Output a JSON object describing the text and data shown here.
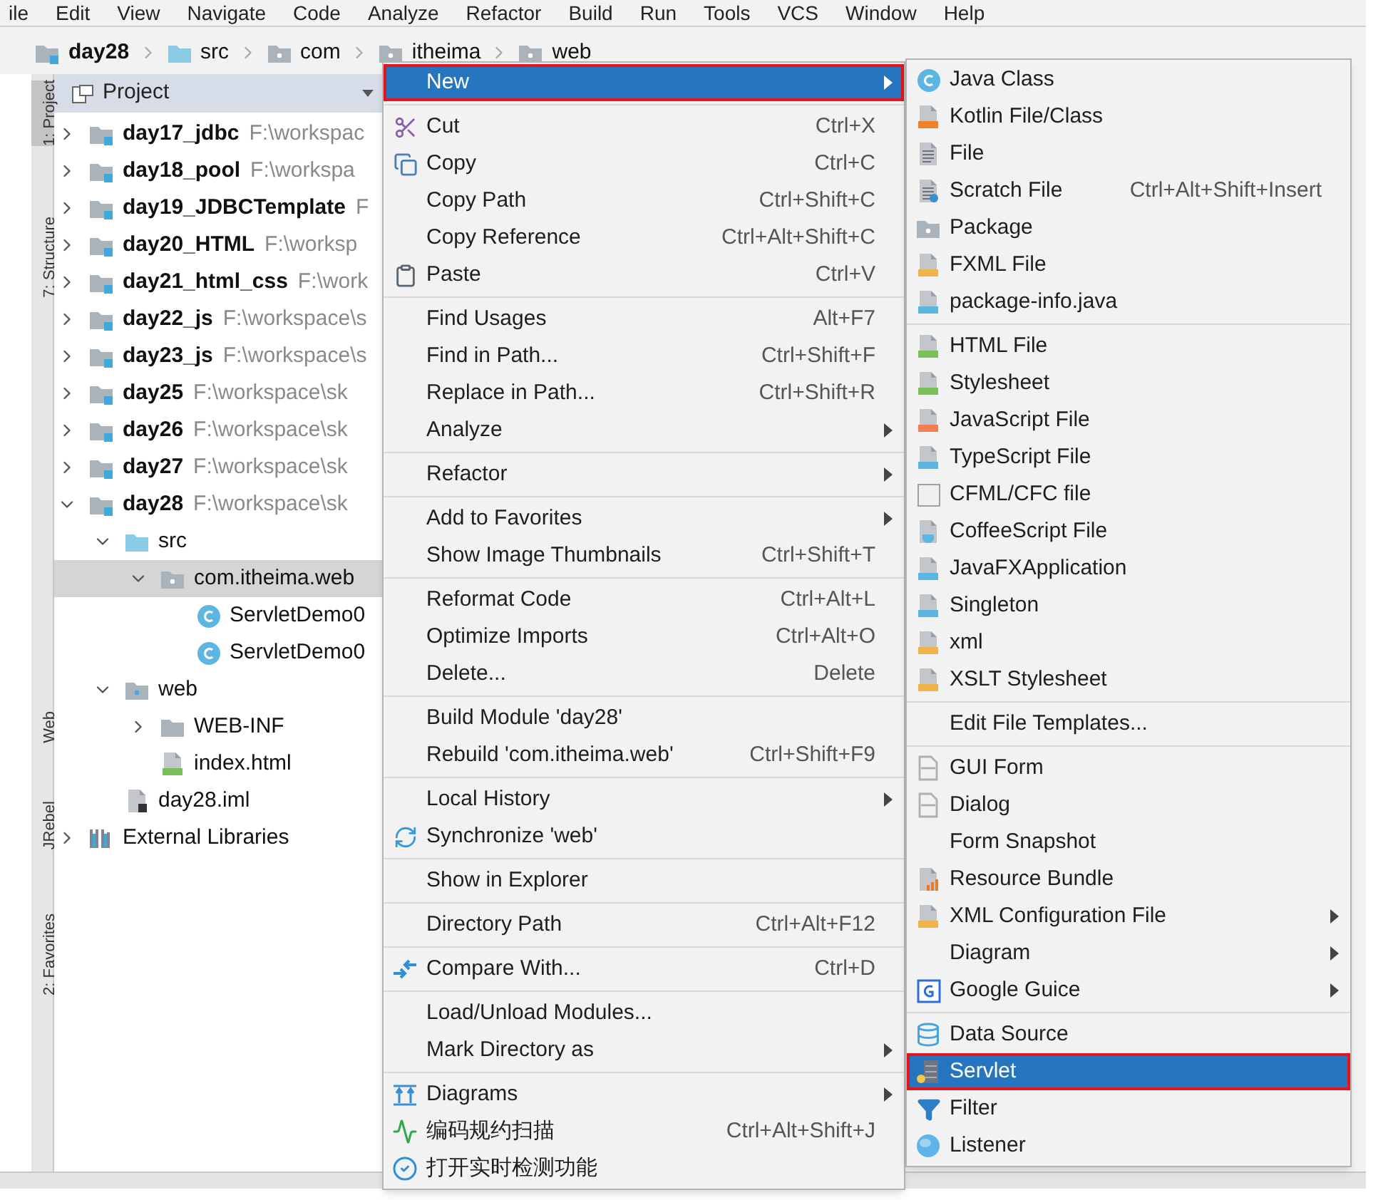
{
  "menu_bar": [
    "ile",
    "Edit",
    "View",
    "Navigate",
    "Code",
    "Analyze",
    "Refactor",
    "Build",
    "Run",
    "Tools",
    "VCS",
    "Window",
    "Help"
  ],
  "breadcrumbs": [
    {
      "label": "day28",
      "kind": "module"
    },
    {
      "label": "src",
      "kind": "source-folder"
    },
    {
      "label": "com",
      "kind": "package"
    },
    {
      "label": "itheima",
      "kind": "package"
    },
    {
      "label": "web",
      "kind": "package"
    }
  ],
  "tool_window_tabs": [
    {
      "label": "1: Project",
      "selected": true
    },
    {
      "label": "7: Structure",
      "selected": false
    },
    {
      "label": "Web",
      "selected": false
    },
    {
      "label": "JRebel",
      "selected": false
    },
    {
      "label": "2: Favorites",
      "selected": false
    }
  ],
  "project_panel": {
    "title": "Project",
    "tree": [
      {
        "name": "day17_jdbc",
        "path": "F:\\workspac",
        "kind": "module",
        "expanded": false,
        "selected": false
      },
      {
        "name": "day18_pool",
        "path": "F:\\workspa",
        "kind": "module",
        "expanded": false,
        "selected": false
      },
      {
        "name": "day19_JDBCTemplate",
        "path": "F",
        "kind": "module",
        "expanded": false,
        "selected": false
      },
      {
        "name": "day20_HTML",
        "path": "F:\\worksp",
        "kind": "module",
        "expanded": false,
        "selected": false
      },
      {
        "name": "day21_html_css",
        "path": "F:\\work",
        "kind": "module",
        "expanded": false,
        "selected": false
      },
      {
        "name": "day22_js",
        "path": "F:\\workspace\\s",
        "kind": "module",
        "expanded": false,
        "selected": false
      },
      {
        "name": "day23_js",
        "path": "F:\\workspace\\s",
        "kind": "module",
        "expanded": false,
        "selected": false
      },
      {
        "name": "day25",
        "path": "F:\\workspace\\sk",
        "kind": "module",
        "expanded": false,
        "selected": false
      },
      {
        "name": "day26",
        "path": "F:\\workspace\\sk",
        "kind": "module",
        "expanded": false,
        "selected": false
      },
      {
        "name": "day27",
        "path": "F:\\workspace\\sk",
        "kind": "module",
        "expanded": false,
        "selected": false
      },
      {
        "name": "day28",
        "path": "F:\\workspace\\sk",
        "kind": "module",
        "expanded": true,
        "selected": false,
        "children": [
          {
            "name": "src",
            "kind": "source-folder",
            "expanded": true,
            "selected": false,
            "children": [
              {
                "name": "com.itheima.web",
                "kind": "package",
                "expanded": true,
                "selected": true,
                "children": [
                  {
                    "name": "ServletDemo0",
                    "kind": "class",
                    "selected": false
                  },
                  {
                    "name": "ServletDemo0",
                    "kind": "class",
                    "selected": false
                  }
                ]
              }
            ]
          },
          {
            "name": "web",
            "kind": "web-folder",
            "expanded": true,
            "selected": false,
            "children": [
              {
                "name": "WEB-INF",
                "kind": "folder",
                "expanded": false,
                "selected": false
              },
              {
                "name": "index.html",
                "kind": "html-file",
                "selected": false
              }
            ]
          },
          {
            "name": "day28.iml",
            "kind": "module-file",
            "selected": false
          }
        ]
      },
      {
        "name": "External Libraries",
        "kind": "libraries",
        "expanded": false,
        "selected": false
      }
    ]
  },
  "context_menu": {
    "groups": [
      [
        {
          "label": "New",
          "has_submenu": true,
          "selected": true
        }
      ],
      [
        {
          "label": "Cut",
          "shortcut": "Ctrl+X",
          "has_submenu": false,
          "selected": false
        },
        {
          "label": "Copy",
          "shortcut": "Ctrl+C",
          "has_submenu": false,
          "selected": false
        },
        {
          "label": "Copy Path",
          "shortcut": "Ctrl+Shift+C",
          "has_submenu": false,
          "selected": false
        },
        {
          "label": "Copy Reference",
          "shortcut": "Ctrl+Alt+Shift+C",
          "has_submenu": false,
          "selected": false
        },
        {
          "label": "Paste",
          "shortcut": "Ctrl+V",
          "has_submenu": false,
          "selected": false
        }
      ],
      [
        {
          "label": "Find Usages",
          "shortcut": "Alt+F7",
          "has_submenu": false,
          "selected": false
        },
        {
          "label": "Find in Path...",
          "shortcut": "Ctrl+Shift+F",
          "has_submenu": false,
          "selected": false
        },
        {
          "label": "Replace in Path...",
          "shortcut": "Ctrl+Shift+R",
          "has_submenu": false,
          "selected": false
        },
        {
          "label": "Analyze",
          "has_submenu": true,
          "selected": false
        }
      ],
      [
        {
          "label": "Refactor",
          "has_submenu": true,
          "selected": false
        }
      ],
      [
        {
          "label": "Add to Favorites",
          "has_submenu": true,
          "selected": false
        },
        {
          "label": "Show Image Thumbnails",
          "shortcut": "Ctrl+Shift+T",
          "has_submenu": false,
          "selected": false
        }
      ],
      [
        {
          "label": "Reformat Code",
          "shortcut": "Ctrl+Alt+L",
          "has_submenu": false,
          "selected": false
        },
        {
          "label": "Optimize Imports",
          "shortcut": "Ctrl+Alt+O",
          "has_submenu": false,
          "selected": false
        },
        {
          "label": "Delete...",
          "shortcut": "Delete",
          "has_submenu": false,
          "selected": false
        }
      ],
      [
        {
          "label": "Build Module 'day28'",
          "has_submenu": false,
          "selected": false
        },
        {
          "label": "Rebuild 'com.itheima.web'",
          "shortcut": "Ctrl+Shift+F9",
          "has_submenu": false,
          "selected": false
        }
      ],
      [
        {
          "label": "Local History",
          "has_submenu": true,
          "selected": false
        },
        {
          "label": "Synchronize 'web'",
          "has_submenu": false,
          "selected": false
        }
      ],
      [
        {
          "label": "Show in Explorer",
          "has_submenu": false,
          "selected": false
        }
      ],
      [
        {
          "label": "Directory Path",
          "shortcut": "Ctrl+Alt+F12",
          "has_submenu": false,
          "selected": false
        }
      ],
      [
        {
          "label": "Compare With...",
          "shortcut": "Ctrl+D",
          "has_submenu": false,
          "selected": false
        }
      ],
      [
        {
          "label": "Load/Unload Modules...",
          "has_submenu": false,
          "selected": false
        },
        {
          "label": "Mark Directory as",
          "has_submenu": true,
          "selected": false
        }
      ],
      [
        {
          "label": "Diagrams",
          "has_submenu": true,
          "selected": false
        },
        {
          "label": "编码规约扫描",
          "shortcut": "Ctrl+Alt+Shift+J",
          "has_submenu": false,
          "selected": false
        },
        {
          "label": "打开实时检测功能",
          "has_submenu": false,
          "selected": false
        }
      ]
    ]
  },
  "new_submenu": {
    "groups": [
      [
        {
          "label": "Java Class",
          "has_submenu": false,
          "selected": false
        },
        {
          "label": "Kotlin File/Class",
          "has_submenu": false,
          "selected": false
        },
        {
          "label": "File",
          "has_submenu": false,
          "selected": false
        },
        {
          "label": "Scratch File",
          "shortcut": "Ctrl+Alt+Shift+Insert",
          "has_submenu": false,
          "selected": false
        },
        {
          "label": "Package",
          "has_submenu": false,
          "selected": false
        },
        {
          "label": "FXML File",
          "has_submenu": false,
          "selected": false
        },
        {
          "label": "package-info.java",
          "has_submenu": false,
          "selected": false
        }
      ],
      [
        {
          "label": "HTML File",
          "has_submenu": false,
          "selected": false
        },
        {
          "label": "Stylesheet",
          "has_submenu": false,
          "selected": false
        },
        {
          "label": "JavaScript File",
          "has_submenu": false,
          "selected": false
        },
        {
          "label": "TypeScript File",
          "has_submenu": false,
          "selected": false
        },
        {
          "label": "CFML/CFC file",
          "has_submenu": false,
          "selected": false
        },
        {
          "label": "CoffeeScript File",
          "has_submenu": false,
          "selected": false
        },
        {
          "label": "JavaFXApplication",
          "has_submenu": false,
          "selected": false
        },
        {
          "label": "Singleton",
          "has_submenu": false,
          "selected": false
        },
        {
          "label": "xml",
          "has_submenu": false,
          "selected": false
        },
        {
          "label": "XSLT Stylesheet",
          "has_submenu": false,
          "selected": false
        }
      ],
      [
        {
          "label": "Edit File Templates...",
          "has_submenu": false,
          "selected": false
        }
      ],
      [
        {
          "label": "GUI Form",
          "has_submenu": false,
          "selected": false
        },
        {
          "label": "Dialog",
          "has_submenu": false,
          "selected": false
        },
        {
          "label": "Form Snapshot",
          "has_submenu": false,
          "selected": false
        },
        {
          "label": "Resource Bundle",
          "has_submenu": false,
          "selected": false
        },
        {
          "label": "XML Configuration File",
          "has_submenu": true,
          "selected": false
        },
        {
          "label": "Diagram",
          "has_submenu": true,
          "selected": false
        },
        {
          "label": "Google Guice",
          "has_submenu": true,
          "selected": false
        }
      ],
      [
        {
          "label": "Data Source",
          "has_submenu": false,
          "selected": false
        },
        {
          "label": "Servlet",
          "has_submenu": false,
          "selected": true
        },
        {
          "label": "Filter",
          "has_submenu": false,
          "selected": false
        },
        {
          "label": "Listener",
          "has_submenu": false,
          "selected": false
        }
      ]
    ]
  }
}
